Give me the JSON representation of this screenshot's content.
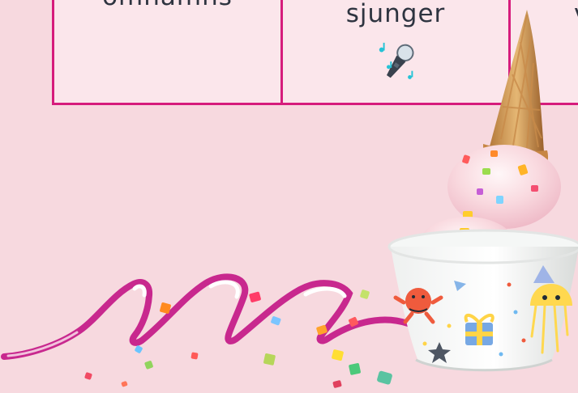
{
  "table": {
    "cells": [
      {
        "label": "omnämns"
      },
      {
        "label": "sjunger"
      },
      {
        "label": "v"
      }
    ]
  },
  "icons": {
    "mic": "microphone-icon",
    "ribbon": "party-ribbon",
    "ice_cream": "ice-cream-sundae-image"
  },
  "colors": {
    "background": "#f7d9df",
    "table_border": "#d61c7c",
    "ribbon": "#c8288e"
  }
}
